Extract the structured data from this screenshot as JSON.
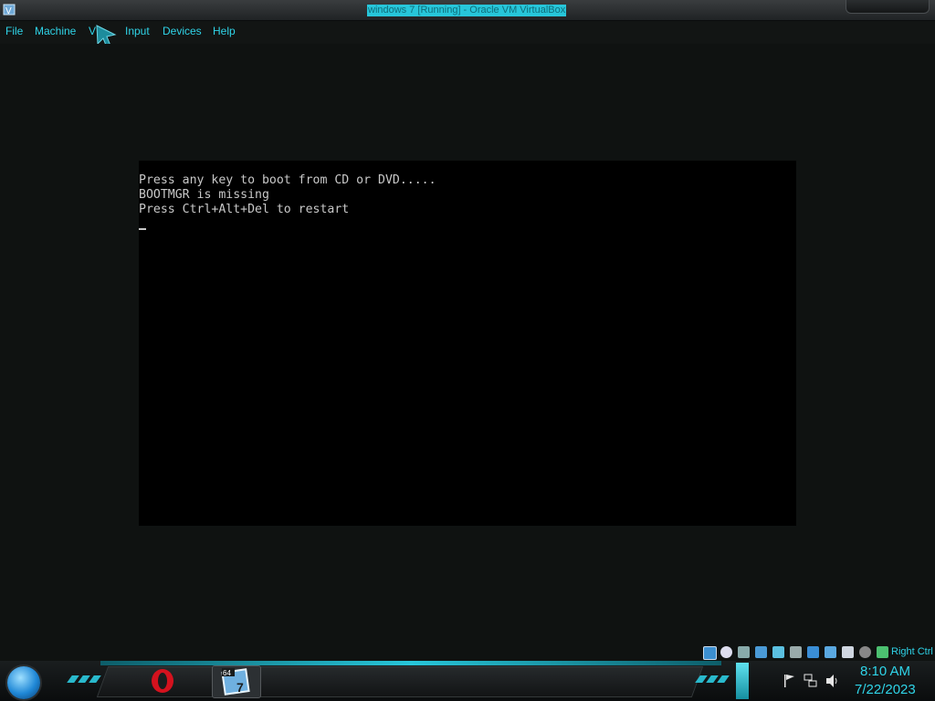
{
  "window": {
    "title": "windows 7 [Running] - Oracle VM VirtualBox"
  },
  "menu": {
    "items": [
      "File",
      "Machine",
      "V",
      "Input",
      "Devices",
      "Help"
    ]
  },
  "console": {
    "lines": [
      "Press any key to boot from CD or DVD.....",
      "BOOTMGR is missing",
      "Press Ctrl+Alt+Del to restart"
    ],
    "cursor": "_"
  },
  "statusbar": {
    "host_key_label": "Right Ctrl",
    "icons": [
      "hard-disk-icon",
      "optical-drive-icon",
      "audio-icon",
      "network-icon",
      "usb-icon",
      "shared-folders-icon",
      "display-icon",
      "recording-icon",
      "cpu-icon",
      "mouse-integration-icon",
      "keyboard-icon"
    ]
  },
  "taskbar": {
    "pinned": [
      "opera-icon",
      "virtualbox-icon"
    ],
    "vbox_badge": "64",
    "vbox_version": "7"
  },
  "tray": {
    "time": "8:10 AM",
    "date": "7/22/2023",
    "icons": [
      "action-center-flag-icon",
      "network-icon",
      "volume-icon"
    ]
  },
  "colors": {
    "accent": "#2fd4e8",
    "title_highlight": "#27c6da",
    "console_text": "#c8c8c8",
    "background": "#111413"
  }
}
